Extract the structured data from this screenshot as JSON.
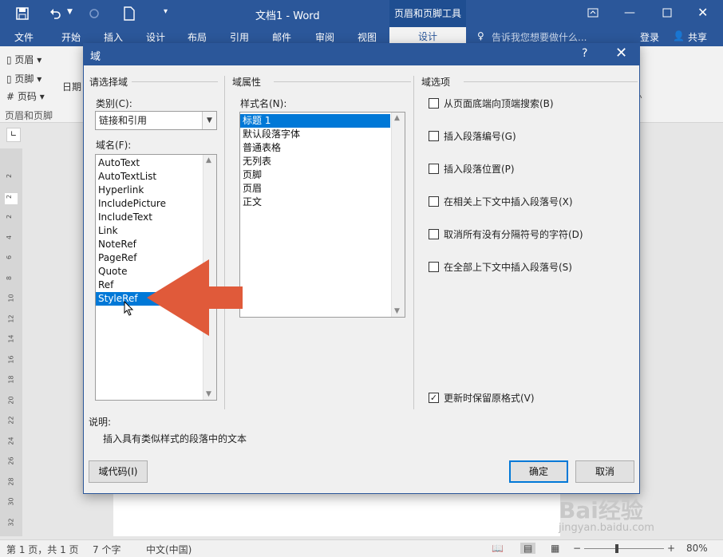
{
  "titlebar": {
    "doc_title": "文档1 - Word",
    "context_tab": "页眉和页脚工具",
    "save_icon": "save-icon",
    "undo_icon": "undo-icon",
    "redo_icon": "redo-icon",
    "new_icon": "new-doc-icon"
  },
  "ribbon_tabs": [
    "文件",
    "开始",
    "插入",
    "设计",
    "布局",
    "引用",
    "邮件",
    "审阅",
    "视图"
  ],
  "design_tab": "设计",
  "tell_me": "告诉我您想要做什么...",
  "login": "登录",
  "share": "共享",
  "ribbon": {
    "items": [
      "页眉",
      "页脚",
      "页码"
    ],
    "group": "页眉和页脚",
    "date_label": "日期"
  },
  "ruler_numbers": [
    "2",
    "2",
    "2",
    "4",
    "6",
    "8",
    "10",
    "12",
    "14",
    "16",
    "18",
    "20",
    "22",
    "24",
    "26",
    "28",
    "30",
    "32"
  ],
  "statusbar": {
    "pages": "第 1 页，共 1 页",
    "words": "7 个字",
    "language": "中文(中国)",
    "zoom": "80%"
  },
  "dialog": {
    "title": "域",
    "help": "?",
    "close": "✕",
    "choose_field": "请选择域",
    "category_label": "类别(C):",
    "category_value": "链接和引用",
    "field_names_label": "域名(F):",
    "field_names": [
      "AutoText",
      "AutoTextList",
      "Hyperlink",
      "IncludePicture",
      "IncludeText",
      "Link",
      "NoteRef",
      "PageRef",
      "Quote",
      "Ref",
      "StyleRef"
    ],
    "selected_field": "StyleRef",
    "field_props": "域属性",
    "style_name_label": "样式名(N):",
    "style_names": [
      "标题 1",
      "默认段落字体",
      "普通表格",
      "无列表",
      "页脚",
      "页眉",
      "正文"
    ],
    "selected_style": "标题 1",
    "field_options": "域选项",
    "options": [
      {
        "label": "从页面底端向顶端搜索(B)",
        "checked": false
      },
      {
        "label": "插入段落编号(G)",
        "checked": false
      },
      {
        "label": "插入段落位置(P)",
        "checked": false
      },
      {
        "label": "在相关上下文中插入段落号(X)",
        "checked": false
      },
      {
        "label": "取消所有没有分隔符号的字符(D)",
        "checked": false
      },
      {
        "label": "在全部上下文中插入段落号(S)",
        "checked": false
      }
    ],
    "preserve_format": {
      "label": "更新时保留原格式(V)",
      "checked": true
    },
    "desc_label": "说明:",
    "desc_text": "插入具有类似样式的段落中的文本",
    "field_codes_button": "域代码(I)",
    "ok": "确定",
    "cancel": "取消"
  },
  "annotation": {
    "arrow_color": "#e05a3a"
  },
  "watermark": {
    "text": "Bai经验",
    "sub": "jingyan.baidu.com"
  }
}
